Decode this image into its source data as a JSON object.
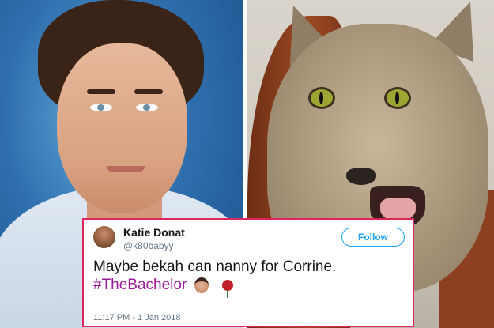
{
  "tweet": {
    "display_name": "Katie Donat",
    "handle": "@k80babyy",
    "follow_label": "Follow",
    "text_line1": "Maybe bekah can nanny for Corrine.",
    "hashtag": "#TheBachelor",
    "emoji_icons": [
      "man-face-emoji-icon",
      "rose-emoji-icon"
    ],
    "timestamp": "11:17 PM - 1 Jan 2018"
  },
  "colors": {
    "border_accent": "#e0245e",
    "follow_blue": "#1da1f2",
    "hashtag_purple": "#9b1b9b"
  }
}
